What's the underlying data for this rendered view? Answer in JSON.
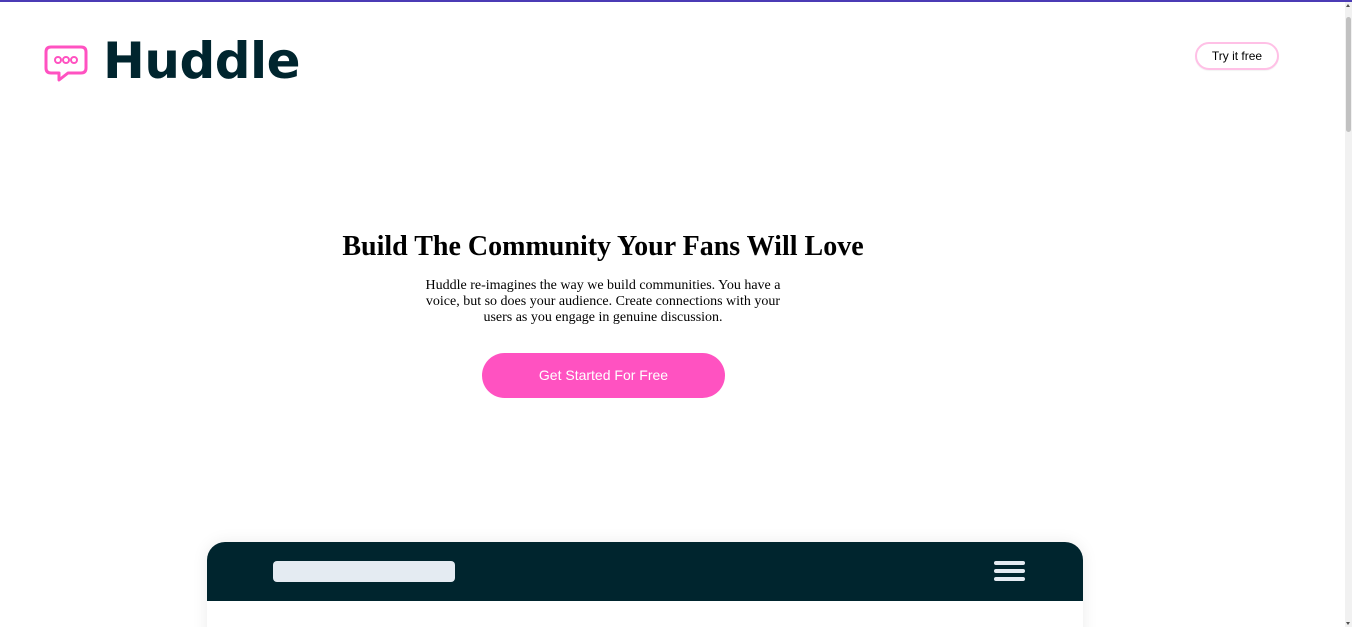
{
  "brand": {
    "name": "Huddle",
    "icon": "speech-bubble-icon",
    "icon_color": "#ff52c1",
    "text_color": "#00252e"
  },
  "header": {
    "cta_label": "Try it free"
  },
  "hero": {
    "title": "Build The Community Your Fans Will Love",
    "description": "Huddle re-imagines the way we build communities. You have a voice, but so does your audience. Create connections with your users as you engage in genuine discussion.",
    "cta_label": "Get Started For Free"
  },
  "colors": {
    "accent": "#ff52c1",
    "accent_border": "#ffc0e6",
    "dark": "#00252e",
    "mockup_light": "#e4ebf2",
    "top_border": "#4b3bb5"
  },
  "mockup": {
    "menu_icon": "hamburger-menu-icon"
  }
}
